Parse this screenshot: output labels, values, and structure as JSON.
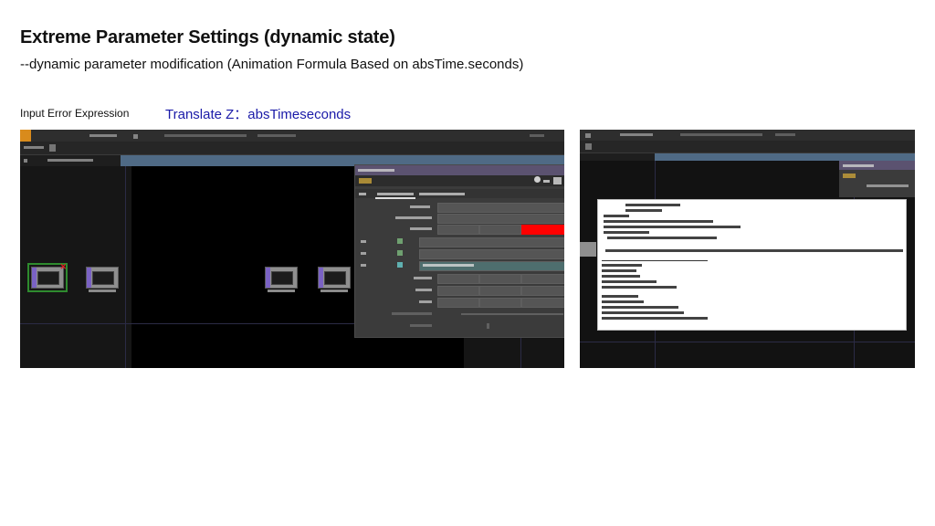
{
  "slide": {
    "title": "Extreme Parameter Settings (dynamic state)",
    "subtitle": "--dynamic parameter modification (Animation Formula Based on absTime.seconds)",
    "left_label": "Input Error Expression",
    "highlight_label": "Translate Z：absTimeseconds"
  },
  "colors": {
    "highlight_text": "#1a1aa8",
    "error_field": "#ff0000",
    "selected_node_outline": "#2e8b2e",
    "param_header": "#5b5270",
    "app_logo": "#d98b1c"
  },
  "screens": {
    "left": {
      "nodes": [
        {
          "icon": "movie-file-node-icon",
          "selected": true,
          "error": true
        },
        {
          "icon": "movie-file-node-icon",
          "selected": false,
          "error": false
        },
        {
          "icon": "movie-file-node-icon",
          "selected": false,
          "error": false
        },
        {
          "icon": "movie-file-node-icon",
          "selected": false,
          "error": false
        }
      ],
      "parameter_panel": {
        "header_icons": [
          "operator-icon",
          "gear-icon",
          "back-icon",
          "add-icon"
        ],
        "error_field_highlighted": true
      }
    },
    "right": {
      "error_dialog": {
        "content_icon": "text-log-icon"
      }
    }
  }
}
